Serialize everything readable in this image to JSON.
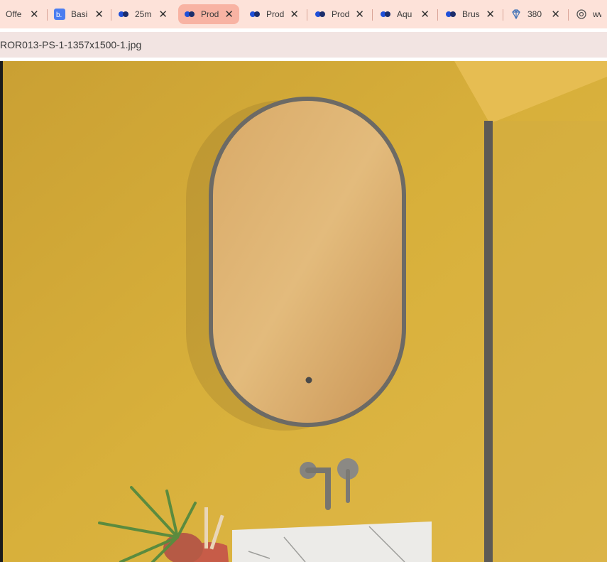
{
  "browser": {
    "tabs": [
      {
        "title": "Offe",
        "favicon": "circle-icon"
      },
      {
        "title": "Basi",
        "favicon": "b-logo-icon"
      },
      {
        "title": "25m",
        "favicon": "dots-logo-icon"
      },
      {
        "title": "Prod",
        "favicon": "dots-logo-icon",
        "active": true
      },
      {
        "title": "Prod",
        "favicon": "dots-logo-icon"
      },
      {
        "title": "Prod",
        "favicon": "dots-logo-icon"
      },
      {
        "title": "Aqu",
        "favicon": "dots-logo-icon"
      },
      {
        "title": "Brus",
        "favicon": "dots-logo-icon"
      },
      {
        "title": "380",
        "favicon": "diamond-icon"
      },
      {
        "title": "www",
        "favicon": "gear-icon"
      }
    ],
    "close_glyph": "✕",
    "address": "ROR013-PS-1-1357x1500-1.jpg"
  },
  "image": {
    "subject": "oval-mirror-bathroom-photo",
    "colors": {
      "wall": "#dbb33c",
      "mirror": "#d7a865",
      "frame": "#6c6a65",
      "basin": "#ecebe8"
    }
  }
}
